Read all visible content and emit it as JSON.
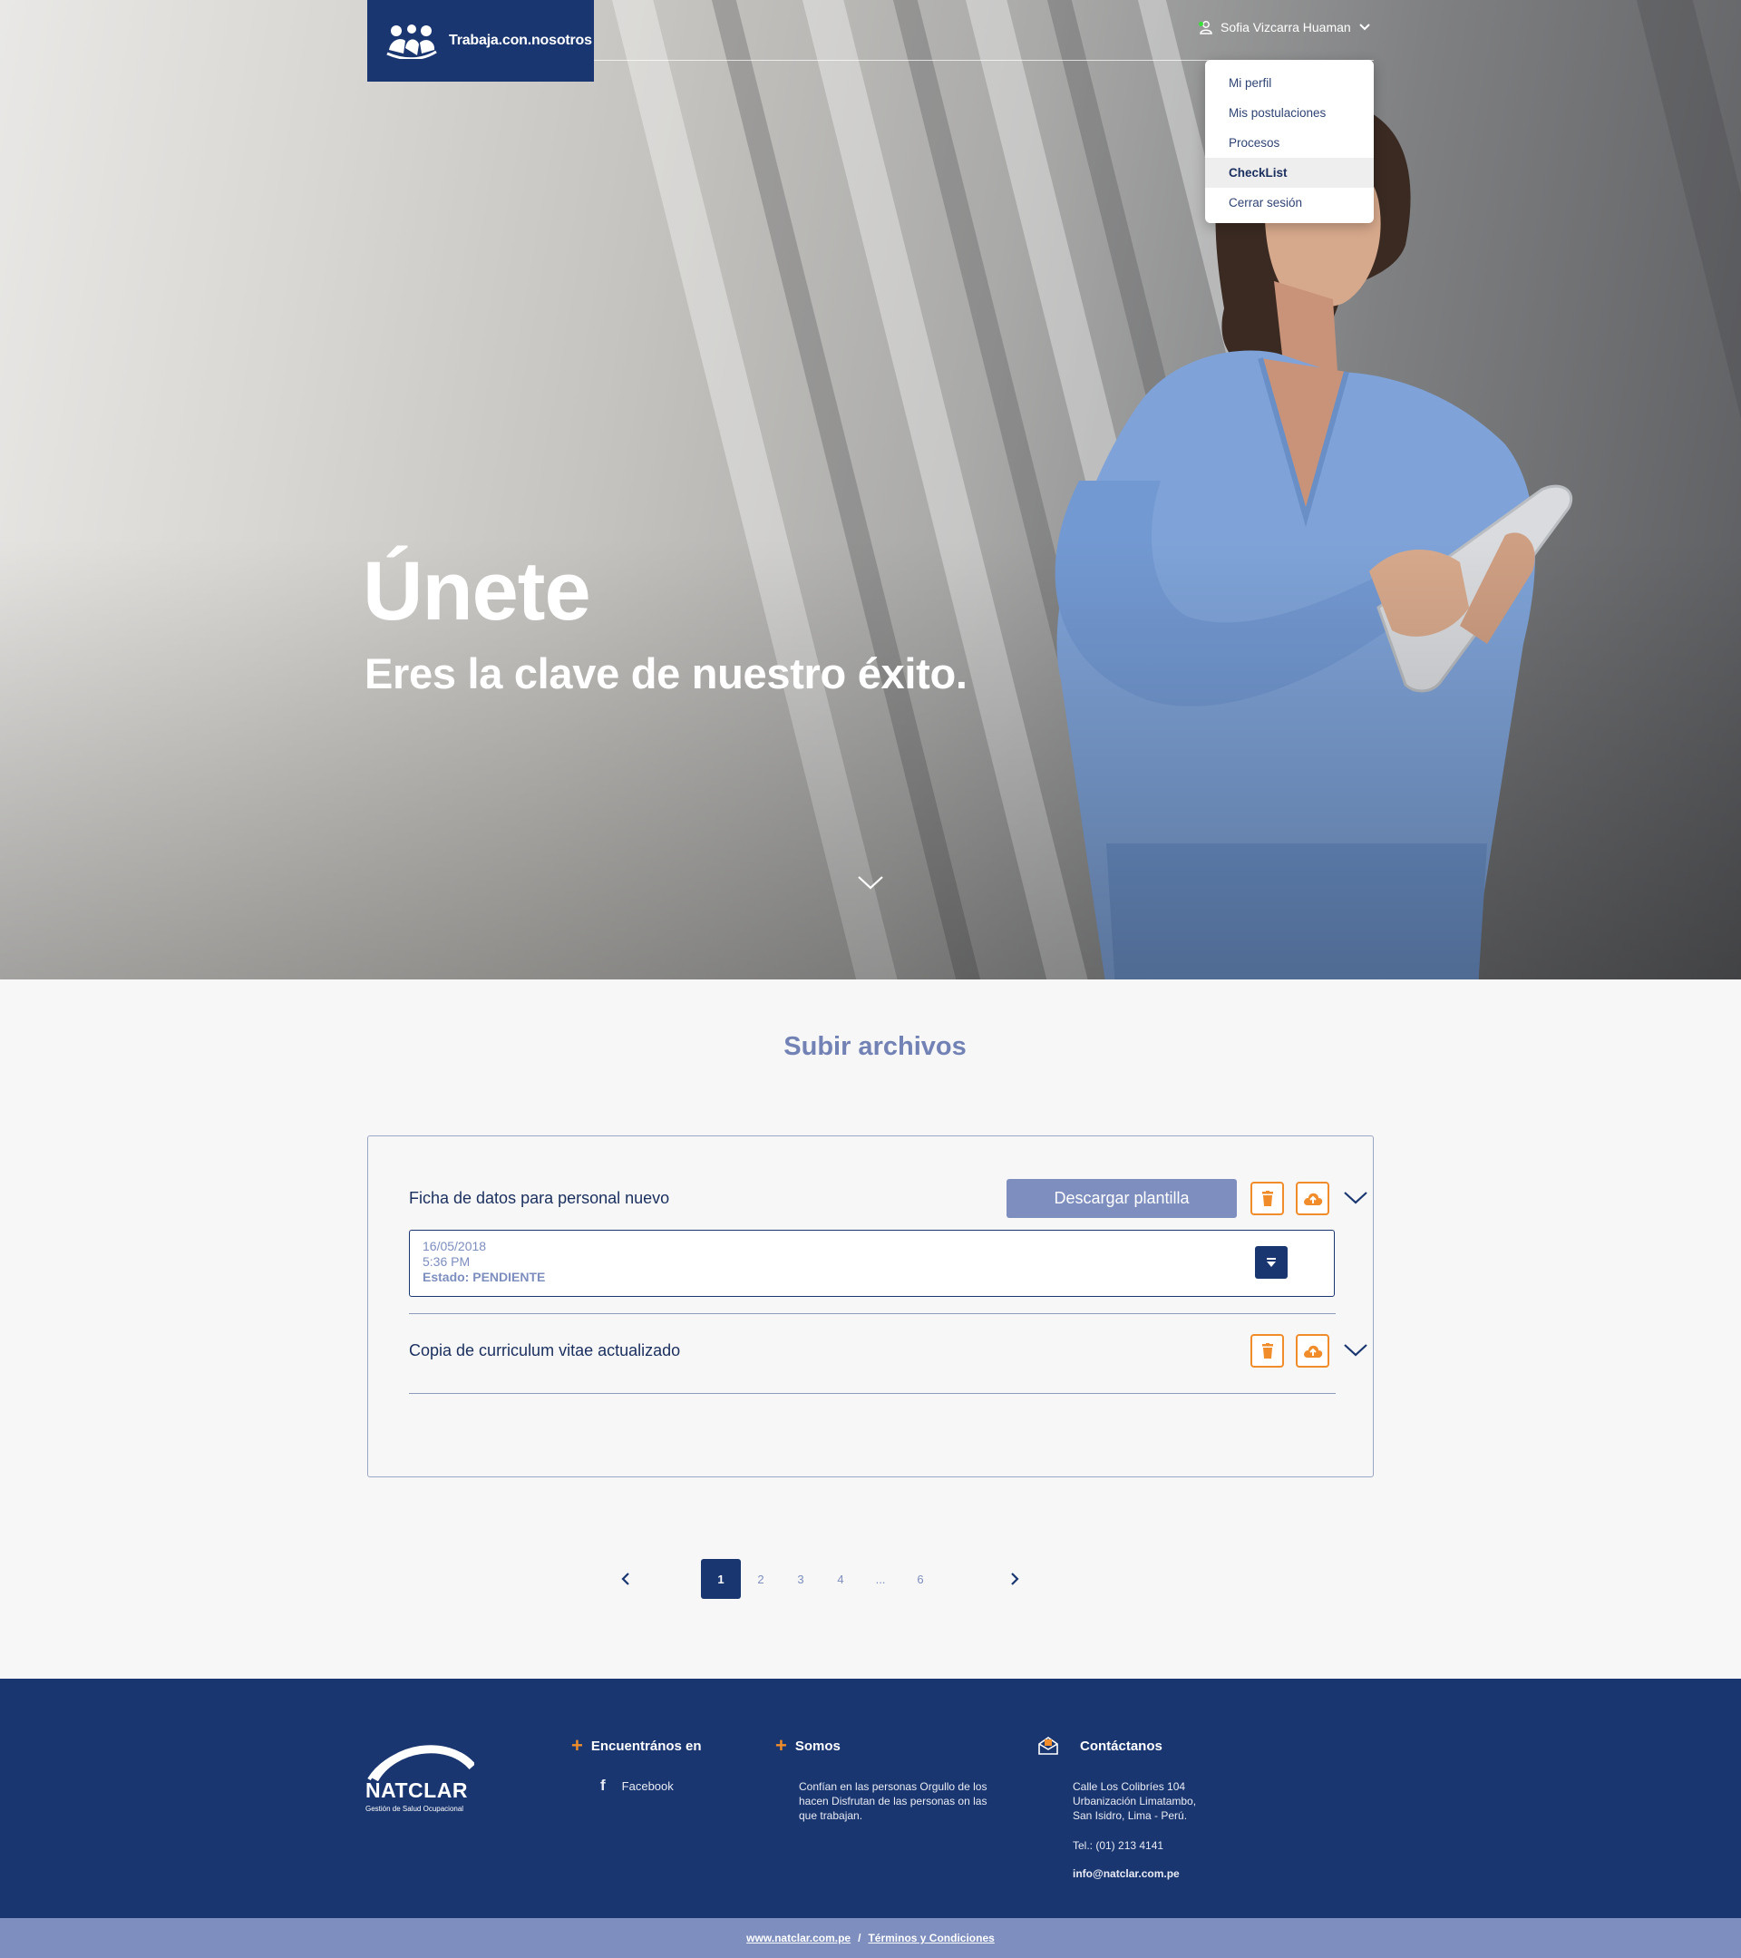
{
  "header": {
    "logo_text": "Trabaja.con.nosotros",
    "user_name": "Sofia Vizcarra Huaman",
    "user_menu": [
      {
        "label": "Mi perfil"
      },
      {
        "label": "Mis postulaciones"
      },
      {
        "label": "Procesos"
      },
      {
        "label": "CheckList"
      },
      {
        "label": "Cerrar sesión"
      }
    ],
    "active_menu_item": "CheckList"
  },
  "hero": {
    "title": "Únete",
    "subtitle": "Eres la clave de nuestro éxito."
  },
  "main": {
    "section_title": "Subir archivos",
    "documents": [
      {
        "label": "Ficha de datos para personal nuevo",
        "template_button": "Descargar plantilla",
        "file": {
          "date": "16/05/2018",
          "time": "5:36 PM",
          "status": "Estado: PENDIENTE"
        }
      },
      {
        "label": "Copia de curriculum vitae actualizado"
      }
    ]
  },
  "pagination": {
    "pages": [
      "1",
      "2",
      "3",
      "4",
      "...",
      "6"
    ],
    "current": "1"
  },
  "footer": {
    "brand": "NATCLAR",
    "brand_sub": "Gestión de Salud Ocupacional",
    "find_us_title": "Encuentrános en",
    "facebook": "Facebook",
    "about_title": "Somos",
    "about_text": "Confían en las personas Orgullo de los hacen Disfrutan de las personas on las que trabajan.",
    "contact_title": "Contáctanos",
    "address": "Calle Los Colibríes 104 Urbanización Limatambo, San Isidro, Lima - Perú.",
    "phone": "Tel.: (01) 213 4141",
    "email": "info@natclar.com.pe",
    "website": "www.natclar.com.pe",
    "separator": "/",
    "terms": "Términos y Condiciones"
  },
  "colors": {
    "navy": "#1a3670",
    "accent_orange": "#f08c2a",
    "muted_blue": "#7d8ebf"
  }
}
